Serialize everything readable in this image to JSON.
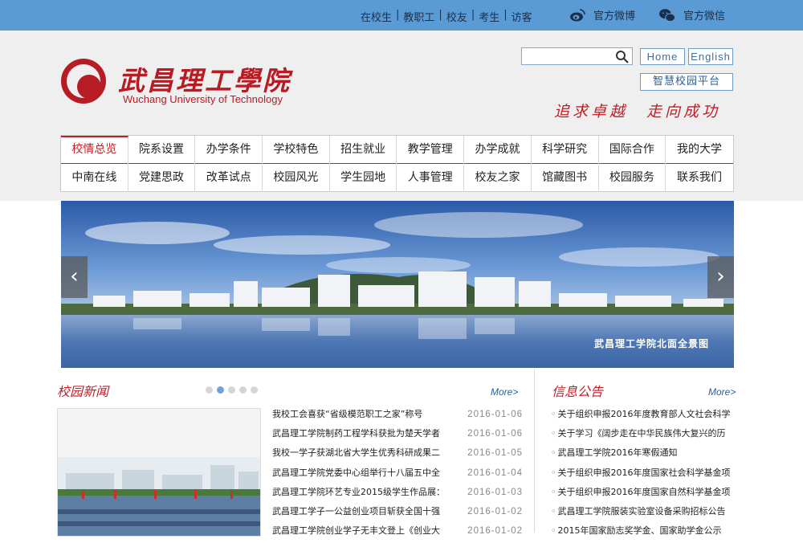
{
  "topbar": {
    "links": [
      "在校生",
      "教职工",
      "校友",
      "考生",
      "访客"
    ],
    "weibo_label": "官方微博",
    "wechat_label": "官方微信"
  },
  "header": {
    "logo_cn": "武昌理工學院",
    "logo_en": "Wuchang University of Technology",
    "search_placeholder": "",
    "home_label": "Home",
    "english_label": "English",
    "portal_label": "智慧校园平台",
    "slogan": "追求卓越　走向成功"
  },
  "nav": {
    "row1": [
      "校情总览",
      "院系设置",
      "办学条件",
      "学校特色",
      "招生就业",
      "教学管理",
      "办学成就",
      "科学研究",
      "国际合作",
      "我的大学"
    ],
    "row2": [
      "中南在线",
      "党建思政",
      "改革试点",
      "校园风光",
      "学生园地",
      "人事管理",
      "校友之家",
      "馆藏图书",
      "校园服务",
      "联系我们"
    ],
    "active": "校情总览"
  },
  "banner": {
    "caption": "武昌理工学院北面全景图",
    "prev_icon": "‹",
    "next_icon": "›"
  },
  "news": {
    "title": "校园新闻",
    "more": "More>",
    "items": [
      {
        "title": "我校工会喜获“省级模范职工之家”称号",
        "date": "2016-01-06"
      },
      {
        "title": "武昌理工学院制药工程学科获批为楚天学者",
        "date": "2016-01-06"
      },
      {
        "title": "我校一学子获湖北省大学生优秀科研成果二",
        "date": "2016-01-05"
      },
      {
        "title": "武昌理工学院党委中心组举行十八届五中全",
        "date": "2016-01-04"
      },
      {
        "title": "武昌理工学院环艺专业2015级学生作品展：",
        "date": "2016-01-03"
      },
      {
        "title": "武昌理工学子一公益创业项目斩获全国十强",
        "date": "2016-01-02"
      },
      {
        "title": "武昌理工学院创业学子无丰文登上《创业大",
        "date": "2016-01-02"
      }
    ]
  },
  "notice": {
    "title": "信息公告",
    "more": "More>",
    "bullet": "◦",
    "items": [
      "关于组织申报2016年度教育部人文社会科学",
      "关于学习《阔步走在中华民族伟大复兴的历",
      "武昌理工学院2016年寒假通知",
      "关于组织申报2016年度国家社会科学基金项",
      "关于组织申报2016年度国家自然科学基金项",
      "武昌理工学院服装实验室设备采购招标公告",
      "2015年国家励志奖学金、国家助学金公示"
    ]
  },
  "colors": {
    "topbar": "#5b9bd5",
    "accent_red": "#c21d25",
    "link_blue": "#2a5f96"
  }
}
